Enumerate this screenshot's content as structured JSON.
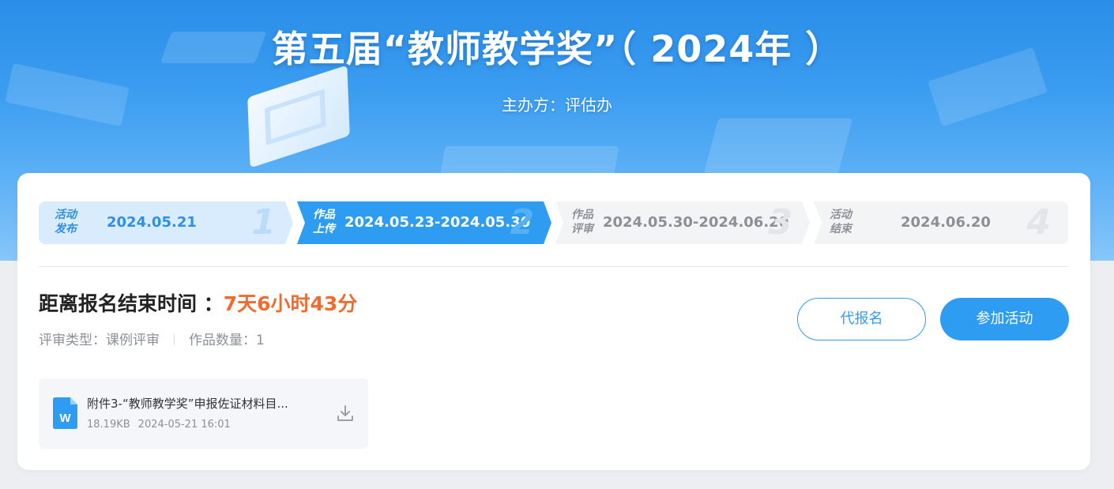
{
  "banner": {
    "title": "第五届“教师教学奖”（ 2024年 ）",
    "subtitle": "主办方：评估办"
  },
  "steps": [
    {
      "label": "活动\n发布",
      "label_line1": "活动",
      "label_line2": "发布",
      "date": "2024.05.21",
      "number": "1",
      "state": "done"
    },
    {
      "label_line1": "作品",
      "label_line2": "上传",
      "date": "2024.05.23-2024.05.30",
      "number": "2",
      "state": "active"
    },
    {
      "label_line1": "作品",
      "label_line2": "评审",
      "date": "2024.05.30-2024.06.20",
      "number": "3",
      "state": "pending"
    },
    {
      "label_line1": "活动",
      "label_line2": "结束",
      "date": "2024.06.20",
      "number": "4",
      "state": "pending"
    }
  ],
  "countdown": {
    "label": "距离报名结束时间 ：",
    "remaining": "7天6小时43分"
  },
  "meta": {
    "review_type": "评审类型：课例评审",
    "work_count": "作品数量：1"
  },
  "actions": {
    "proxy_register": "代报名",
    "join": "参加活动"
  },
  "attachment": {
    "name": "附件3-“教师教学奖”申报佐证材料目...",
    "size": "18.19KB",
    "date": "2024-05-21 16:01",
    "icon": "word-file-icon"
  },
  "colors": {
    "accent": "#2e9cf0",
    "countdown": "#f06b2d",
    "done_step_bg": "#d9ecfd"
  }
}
